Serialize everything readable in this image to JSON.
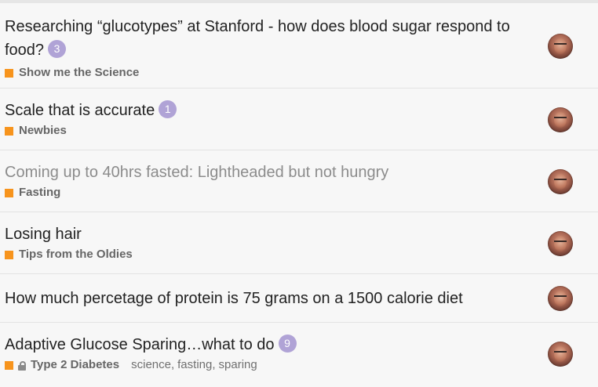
{
  "topics": [
    {
      "title": "Researching “glucotypes” at Stanford - how does blood sugar respond to food?",
      "badge": "3",
      "category": "Show me the Science",
      "visited": false,
      "locked": false,
      "tags": []
    },
    {
      "title": "Scale that is accurate",
      "badge": "1",
      "category": "Newbies",
      "visited": false,
      "locked": false,
      "tags": []
    },
    {
      "title": "Coming up to 40hrs fasted: Lightheaded but not hungry",
      "badge": "",
      "category": "Fasting",
      "visited": true,
      "locked": false,
      "tags": []
    },
    {
      "title": "Losing hair",
      "badge": "",
      "category": "Tips from the Oldies",
      "visited": false,
      "locked": false,
      "tags": []
    },
    {
      "title": "How much percetage of protein is 75 grams on a 1500 calorie diet",
      "badge": "",
      "category": "",
      "visited": false,
      "locked": false,
      "tags": []
    },
    {
      "title": "Adaptive Glucose Sparing…what to do",
      "badge": "9",
      "category": "Type 2 Diabetes",
      "visited": false,
      "locked": true,
      "tags": [
        "science",
        "fasting",
        "sparing"
      ]
    }
  ],
  "colors": {
    "category_square": "#f7941d",
    "badge": "#b0a3d6",
    "title": "#222222",
    "visited_title": "#8c8c8c"
  },
  "icons": {
    "lock": "lock-icon",
    "avatar": "user-avatar"
  }
}
